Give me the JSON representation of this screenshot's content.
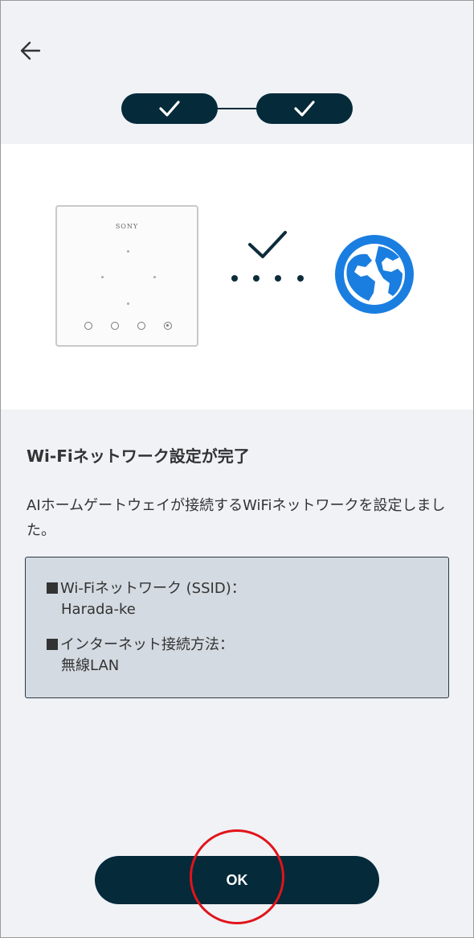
{
  "nav": {
    "back_icon": "arrow-left-icon"
  },
  "stepper": {
    "steps": [
      {
        "status": "done",
        "icon": "check-icon"
      },
      {
        "status": "done",
        "icon": "check-icon"
      }
    ]
  },
  "illustration": {
    "device_brand": "SONY",
    "connection_icon": "check-icon",
    "internet_icon": "globe-icon"
  },
  "content": {
    "title": "Wi-Fiネットワーク設定が完了",
    "description": "AIホームゲートウェイが接続するWiFiネットワークを設定しました。",
    "info": [
      {
        "label": "Wi-Fiネットワーク (SSID)：",
        "value": "Harada-ke"
      },
      {
        "label": "インターネット接続方法：",
        "value": "無線LAN"
      }
    ]
  },
  "footer": {
    "ok_label": "OK"
  },
  "colors": {
    "primary": "#052a3a",
    "background": "#f0f2f6",
    "info_box": "#d4dae1",
    "globe_blue": "#1a7ee0",
    "highlight_red": "#e1141b"
  }
}
